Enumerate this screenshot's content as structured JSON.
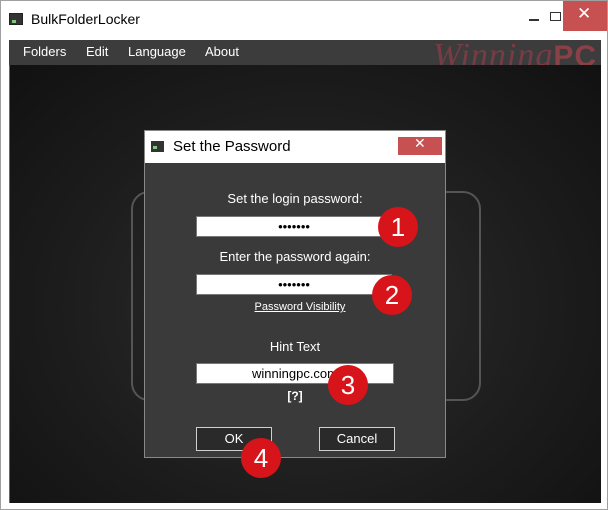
{
  "window": {
    "title": "BulkFolderLocker"
  },
  "menu": {
    "items": [
      "Folders",
      "Edit",
      "Language",
      "About"
    ]
  },
  "watermark": {
    "script": "Winning",
    "bold": "PC"
  },
  "dialog": {
    "title": "Set the Password",
    "login_label": "Set the login password:",
    "password_value": "•••••••",
    "confirm_label": "Enter the password again:",
    "confirm_value": "•••••••",
    "visibility_link": "Password Visibility",
    "hint_label": "Hint Text",
    "hint_value": "winningpc.com",
    "help_label": "[?]",
    "ok_label": "OK",
    "cancel_label": "Cancel"
  },
  "annotations": [
    "1",
    "2",
    "3",
    "4"
  ],
  "colors": {
    "close_button": "#c75050",
    "badge": "#d8141b",
    "menubar": "#3c3c3c",
    "dialog_bg": "#3a3a3a"
  }
}
